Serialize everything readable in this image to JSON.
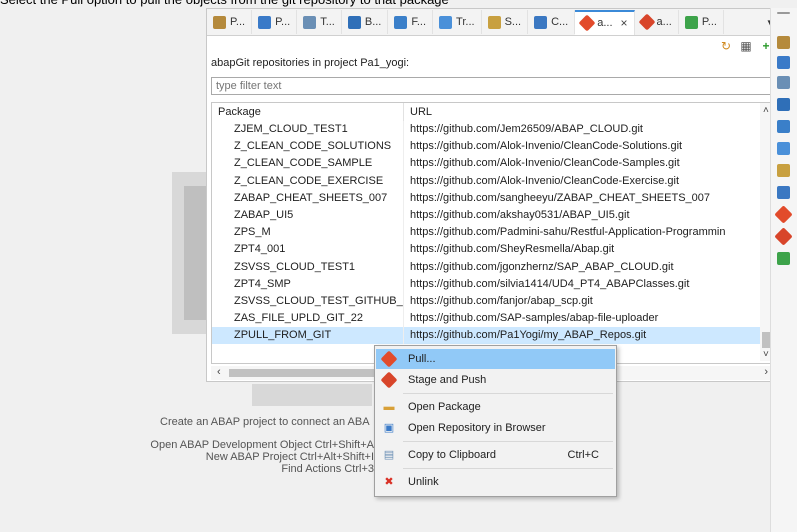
{
  "caption": "Select the Pull option to pull the objects from the git repository to that package",
  "tabs": [
    {
      "label": "P...",
      "icon": "project-explorer-icon",
      "color": "#b58a3c"
    },
    {
      "label": "P...",
      "icon": "properties-icon",
      "color": "#3a7ac8"
    },
    {
      "label": "T...",
      "icon": "transport-icon",
      "color": "#6a8fb5"
    },
    {
      "label": "B...",
      "icon": "bookmarks-icon",
      "color": "#2f6fb8"
    },
    {
      "label": "F...",
      "icon": "feed-icon",
      "color": "#3a7fc9"
    },
    {
      "label": "Tr...",
      "icon": "trace-icon",
      "color": "#4a90d9"
    },
    {
      "label": "S...",
      "icon": "search-icon",
      "color": "#c8a040"
    },
    {
      "label": "C...",
      "icon": "console-icon",
      "color": "#3b78c2"
    },
    {
      "label": "a...",
      "icon": "abapgit-icon",
      "color": "#e24b2b",
      "active": true
    },
    {
      "label": "a...",
      "icon": "abapgit-staging-icon",
      "color": "#d8452a"
    },
    {
      "label": "P...",
      "icon": "problems-icon",
      "color": "#3da34a"
    }
  ],
  "view": {
    "title": "abapGit repositories in project Pa1_yogi:",
    "filter_placeholder": "type filter text",
    "columns": [
      "Package",
      "URL"
    ],
    "rows": [
      {
        "package": "ZJEM_CLOUD_TEST1",
        "url": "https://github.com/Jem26509/ABAP_CLOUD.git"
      },
      {
        "package": "Z_CLEAN_CODE_SOLUTIONS",
        "url": "https://github.com/Alok-Invenio/CleanCode-Solutions.git"
      },
      {
        "package": "Z_CLEAN_CODE_SAMPLE",
        "url": "https://github.com/Alok-Invenio/CleanCode-Samples.git"
      },
      {
        "package": "Z_CLEAN_CODE_EXERCISE",
        "url": "https://github.com/Alok-Invenio/CleanCode-Exercise.git"
      },
      {
        "package": "ZABAP_CHEAT_SHEETS_007",
        "url": "https://github.com/sangheeyu/ZABAP_CHEAT_SHEETS_007"
      },
      {
        "package": "ZABAP_UI5",
        "url": "https://github.com/akshay0531/ABAP_UI5.git"
      },
      {
        "package": "ZPS_M",
        "url": "https://github.com/Padmini-sahu/Restful-Application-Programmin"
      },
      {
        "package": "ZPT4_001",
        "url": "https://github.com/SheyResmella/Abap.git"
      },
      {
        "package": "ZSVSS_CLOUD_TEST1",
        "url": "https://github.com/jgonzhernz/SAP_ABAP_CLOUD.git"
      },
      {
        "package": "ZPT4_SMP",
        "url": "https://github.com/silvia1414/UD4_PT4_ABAPClasses.git"
      },
      {
        "package": "ZSVSS_CLOUD_TEST_GITHUB_C...",
        "url": "https://github.com/fanjor/abap_scp.git"
      },
      {
        "package": "ZAS_FILE_UPLD_GIT_22",
        "url": "https://github.com/SAP-samples/abap-file-uploader"
      },
      {
        "package": "ZPULL_FROM_GIT",
        "url": "https://github.com/Pa1Yogi/my_ABAP_Repos.git",
        "selected": true
      }
    ]
  },
  "context_menu": {
    "items": [
      {
        "label": "Pull...",
        "icon": "abapgit-pull-icon",
        "highlighted": true
      },
      {
        "label": "Stage and Push",
        "icon": "abapgit-push-icon"
      },
      {
        "label": "Open Package",
        "icon": "folder-icon"
      },
      {
        "label": "Open Repository in Browser",
        "icon": "browser-icon"
      },
      {
        "label": "Copy to Clipboard",
        "icon": "clipboard-icon",
        "accelerator": "Ctrl+C"
      },
      {
        "label": "Unlink",
        "icon": "unlink-icon",
        "color": "#d93025"
      }
    ]
  },
  "welcome": {
    "create_text": "Create an ABAP project to connect an ABA",
    "shortcuts": [
      "Open ABAP Development Object  Ctrl+Shift+A",
      "New ABAP Project  Ctrl+Alt+Shift+I",
      "Find Actions  Ctrl+3"
    ]
  },
  "colors": {
    "accent": "#3b8ad8",
    "selection": "#cde8ff",
    "menu_highlight": "#91c9f7",
    "abapgit": "#e24b2b"
  }
}
